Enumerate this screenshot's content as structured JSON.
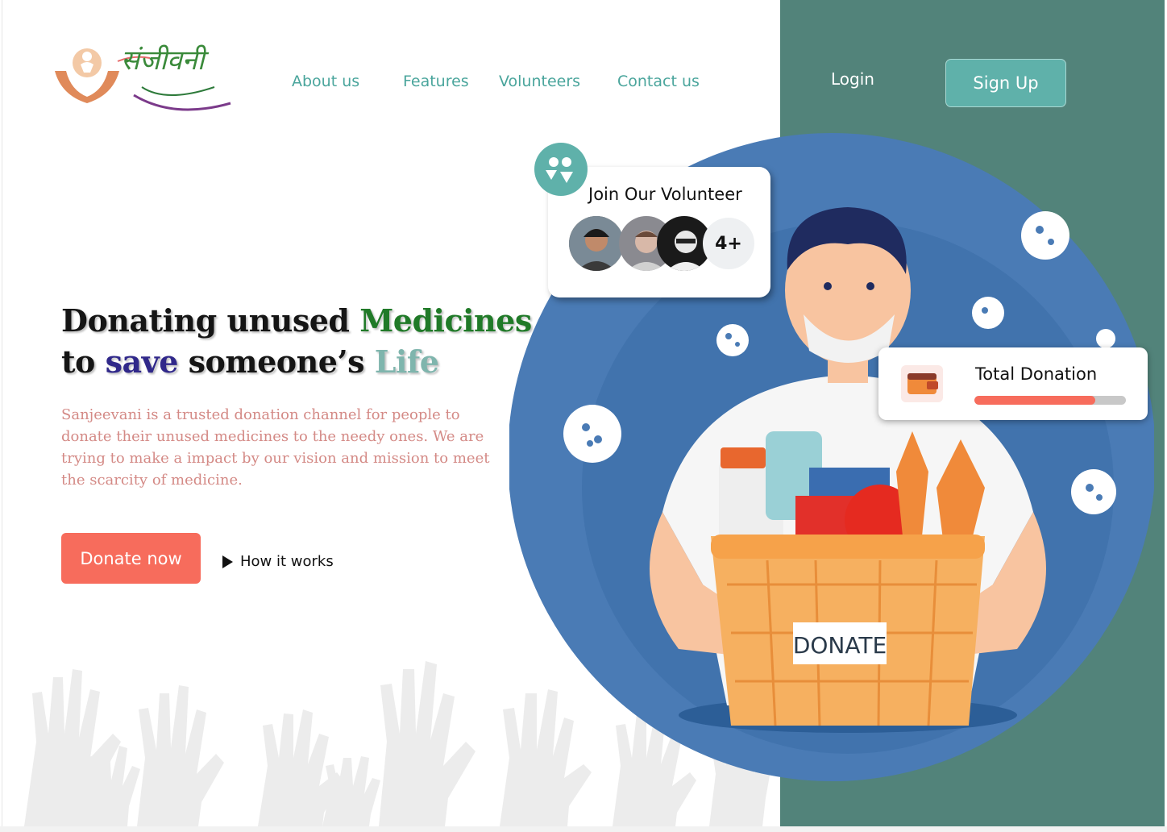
{
  "brand": {
    "logo_text": "संजीवनी",
    "colors": {
      "teal": "#52837a",
      "accent_teal": "#5fb1aa",
      "coral": "#f76c5c",
      "blue_circle": "#4a7bb5"
    }
  },
  "nav": {
    "items": [
      "About us",
      "Features",
      "Volunteers",
      "Contact us"
    ],
    "login": "Login",
    "signup": "Sign Up"
  },
  "hero": {
    "line1_a": "Donating unused ",
    "line1_b": "Medicines",
    "line2_a": "to ",
    "line2_b": "save",
    "line2_c": " someone’s ",
    "line2_d": "Life",
    "description": "Sanjeevani is a trusted donation channel for people to donate their unused medicines to the needy ones. We are trying to make  a impact by our vision and mission to meet the scarcity of medicine.",
    "donate_button": "Donate now",
    "how_it_works": "How it works"
  },
  "volunteer_card": {
    "title": "Join Our Volunteer",
    "more_count": "4+",
    "icon": "volunteer-people-icon"
  },
  "donation_card": {
    "title": "Total Donation",
    "progress": 0.8,
    "icon": "wallet-icon"
  },
  "illustration": {
    "basket_label": "DONATE"
  }
}
